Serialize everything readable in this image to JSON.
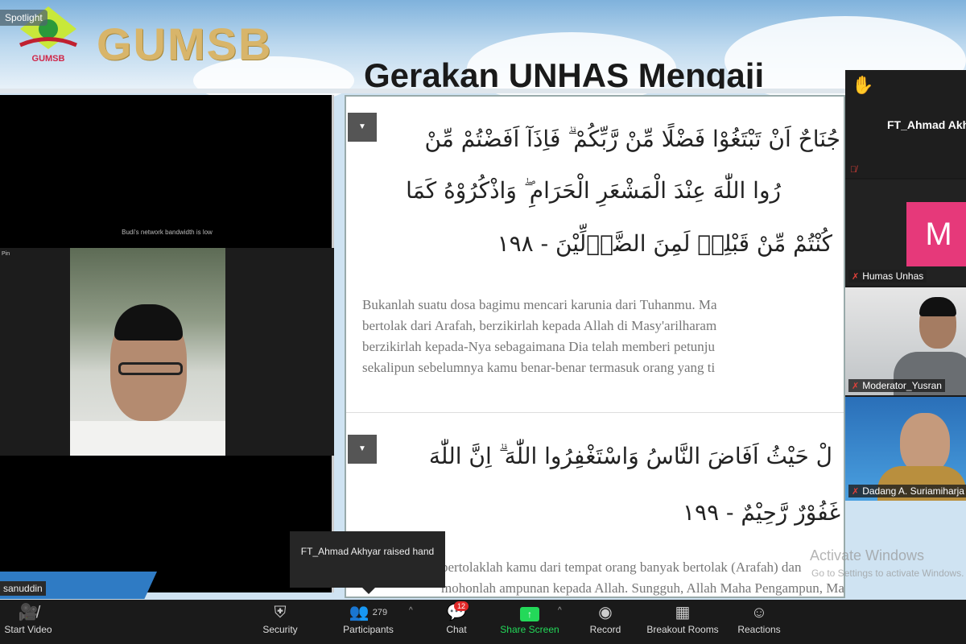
{
  "banner": {
    "spotlight": "Spotlight",
    "brand": "GUMSB",
    "logo_text": "GUMSB",
    "headline": "Gerakan UNHAS Mengaji"
  },
  "left": {
    "bandwidth_note": "Budi's network bandwidth is low",
    "small_name": "Pin",
    "name_label": "sanuddin"
  },
  "share": {
    "arabic_1": [
      "جُنَاحٌ اَنْ تَبْتَغُوْا فَضْلًا مِّنْ رَّبِّكُمْ ۗ فَاِذَآ اَفَضْتُمْ مِّنْ",
      "رُوا اللّٰهَ عِنْدَ الْمَشْعَرِ الْحَرَامِ ۖ وَاذْكُرُوْهُ كَمَا",
      "كُنْتُمْ مِّنْ قَبْلِهٖ لَمِنَ الضَّاۤلِّيْنَ - ١٩٨"
    ],
    "translation_1": [
      "Bukanlah suatu dosa bagimu mencari karunia dari Tuhanmu. Ma",
      "bertolak dari Arafah, berzikirlah kepada Allah di Masy'arilharam",
      "berzikirlah kepada-Nya sebagaimana Dia telah memberi petunju",
      "sekalipun sebelumnya kamu benar-benar termasuk orang yang ti"
    ],
    "arabic_2": [
      "لْ حَيْثُ اَفَاضَ النَّاسُ وَاسْتَغْفِرُوا اللّٰهَ ۗ اِنَّ اللّٰهَ",
      "غَفُوْرٌ رَّحِيْمٌ - ١٩٩"
    ],
    "translation_2": [
      "bertolaklah kamu dari tempat orang banyak bertolak (Arafah) dan",
      "mohonlah ampunan kepada Allah. Sungguh, Allah Maha Pengampun, Maha"
    ]
  },
  "watermark": {
    "title": "Activate Windows",
    "subtitle": "Go to Settings to activate Windows."
  },
  "gallery": [
    {
      "name": "FT_Ahmad Akhyar",
      "raised_hand": true
    },
    {
      "name": "Humas Unhas",
      "avatar_letter": "M",
      "avatar_color": "#e6397a"
    },
    {
      "name": "Moderator_Yusran"
    },
    {
      "name": "Dadang A. Suriamiharja"
    }
  ],
  "tooltip": "FT_Ahmad Akhyar raised hand",
  "toolbar": {
    "start_video": "Start Video",
    "security": "Security",
    "participants": "Participants",
    "participant_count": "279",
    "chat": "Chat",
    "chat_badge": "12",
    "share_screen": "Share Screen",
    "record": "Record",
    "breakout_rooms": "Breakout Rooms",
    "reactions": "Reactions",
    "share_color": "#23d959"
  }
}
